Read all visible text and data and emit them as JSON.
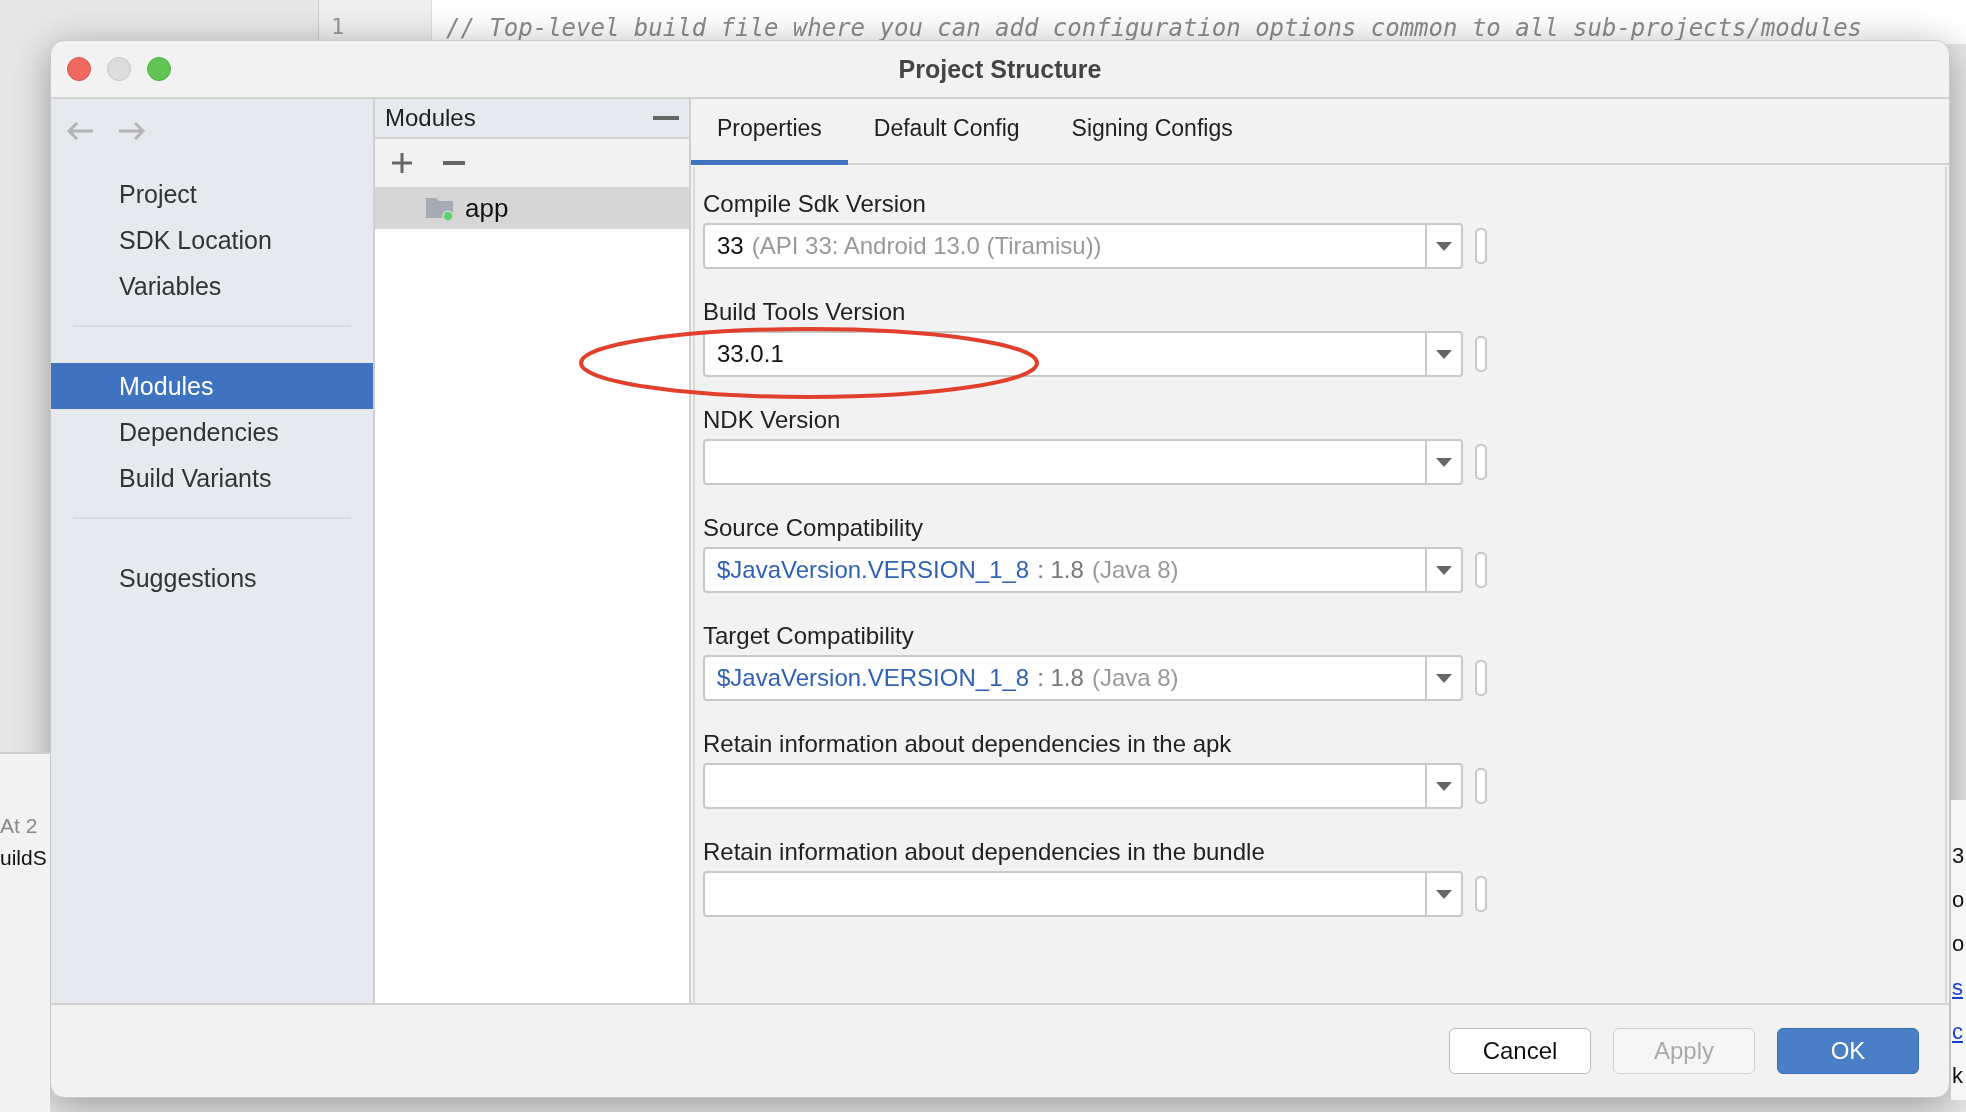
{
  "editor": {
    "line_number": "1",
    "code_line": "// Top-level build file where you can add configuration options common to all sub-projects/modules",
    "left_fragments": [
      "At 2",
      "uildS"
    ],
    "right_fragments": [
      "3",
      "o",
      "o",
      "s",
      "c",
      "k"
    ]
  },
  "window": {
    "title": "Project Structure"
  },
  "sidebar": {
    "items": [
      {
        "label": "Project",
        "selected": false
      },
      {
        "label": "SDK Location",
        "selected": false
      },
      {
        "label": "Variables",
        "selected": false
      },
      {
        "label": "Modules",
        "selected": true
      },
      {
        "label": "Dependencies",
        "selected": false
      },
      {
        "label": "Build Variants",
        "selected": false
      },
      {
        "label": "Suggestions",
        "selected": false
      }
    ]
  },
  "modules": {
    "title": "Modules",
    "items": [
      {
        "label": "app",
        "selected": true
      }
    ]
  },
  "tabs": [
    {
      "label": "Properties",
      "selected": true
    },
    {
      "label": "Default Config",
      "selected": false
    },
    {
      "label": "Signing Configs",
      "selected": false
    }
  ],
  "fields": [
    {
      "label": "Compile Sdk Version",
      "parts": [
        {
          "text": "33",
          "kind": "value"
        },
        {
          "text": "(API 33: Android 13.0 (Tiramisu))",
          "kind": "hint"
        }
      ]
    },
    {
      "label": "Build Tools Version",
      "parts": [
        {
          "text": "33.0.1",
          "kind": "value"
        }
      ]
    },
    {
      "label": "NDK Version"
    },
    {
      "label": "Source Compatibility",
      "parts": [
        {
          "text": "$JavaVersion.VERSION_1_8",
          "kind": "link"
        },
        {
          "text": ": 1.8",
          "kind": "muted"
        },
        {
          "text": "(Java 8)",
          "kind": "hint"
        }
      ]
    },
    {
      "label": "Target Compatibility",
      "parts": [
        {
          "text": "$JavaVersion.VERSION_1_8",
          "kind": "link"
        },
        {
          "text": ": 1.8",
          "kind": "muted"
        },
        {
          "text": "(Java 8)",
          "kind": "hint"
        }
      ]
    },
    {
      "label": "Retain information about dependencies in the apk"
    },
    {
      "label": "Retain information about dependencies in the bundle"
    }
  ],
  "buttons": [
    {
      "label": "Cancel",
      "kind": "default",
      "disabled": false
    },
    {
      "label": "Apply",
      "kind": "default",
      "disabled": true
    },
    {
      "label": "OK",
      "kind": "primary",
      "disabled": false
    }
  ]
}
